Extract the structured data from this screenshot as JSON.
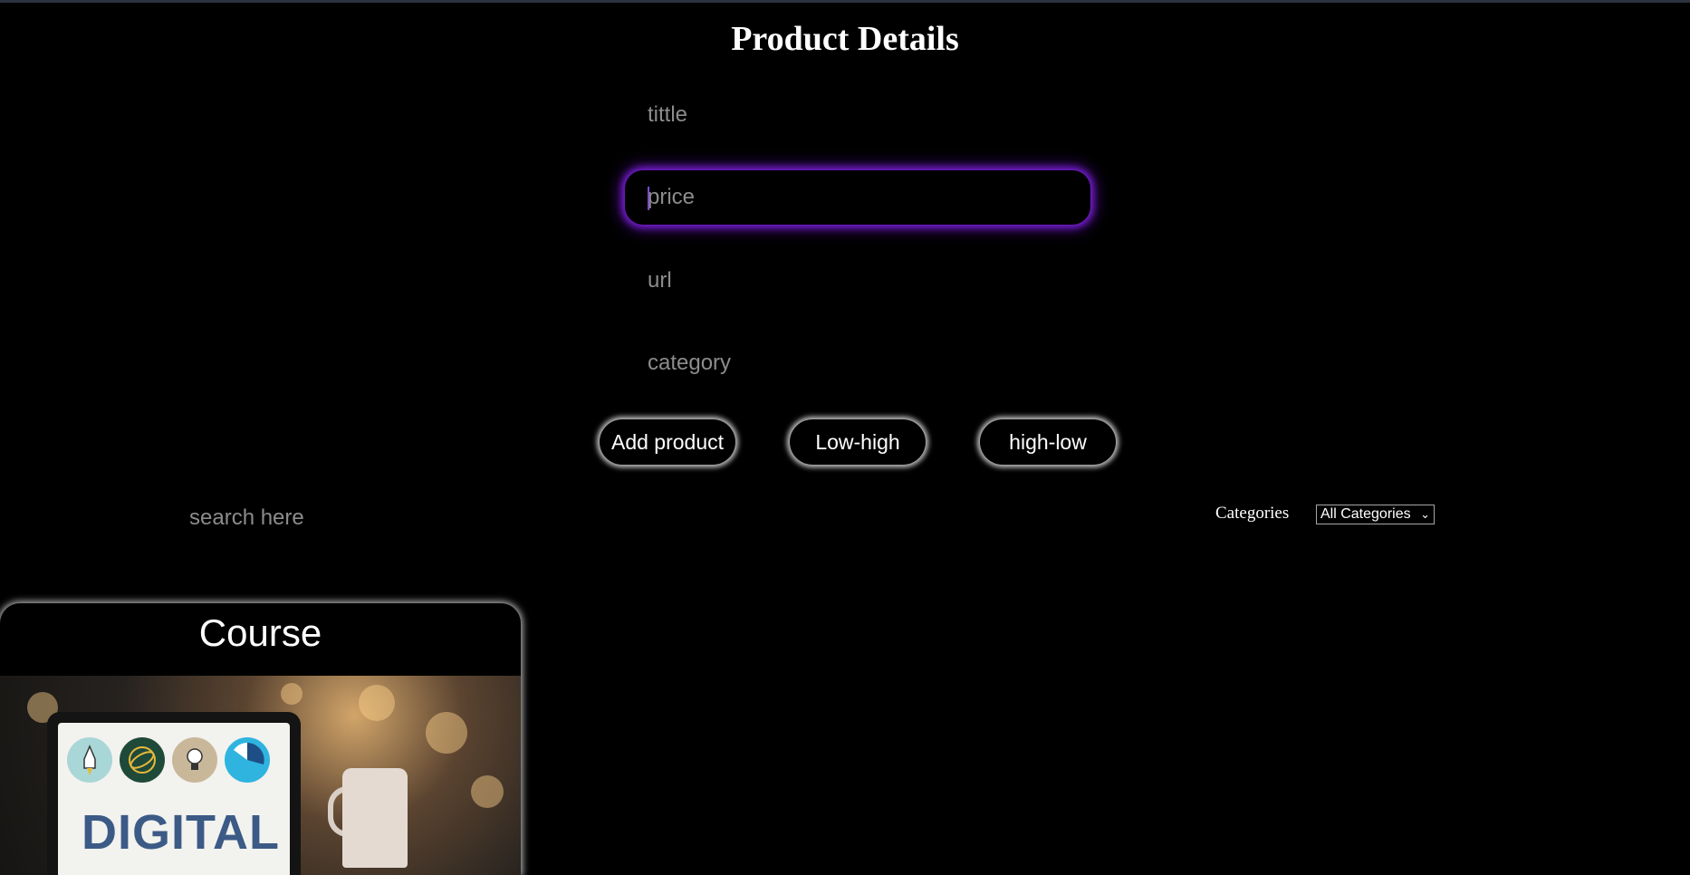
{
  "page": {
    "title": "Product Details"
  },
  "form": {
    "title_placeholder": "tittle",
    "price_placeholder": "price",
    "url_placeholder": "url",
    "category_placeholder": "category"
  },
  "buttons": {
    "add_label": "Add product",
    "low_high_label": "Low-high",
    "high_low_label": "high-low"
  },
  "filters": {
    "search_placeholder": "search here",
    "categories_label": "Categories",
    "categories_selected": "All Categories",
    "dropdown_arrow": "⌄"
  },
  "card": {
    "title": "Course",
    "image_text": "DIGITAL"
  },
  "colors": {
    "background": "#000000",
    "focus_glow": "#7a1fd6",
    "button_glow": "#e6e6e6",
    "placeholder": "#8c8c8c"
  }
}
